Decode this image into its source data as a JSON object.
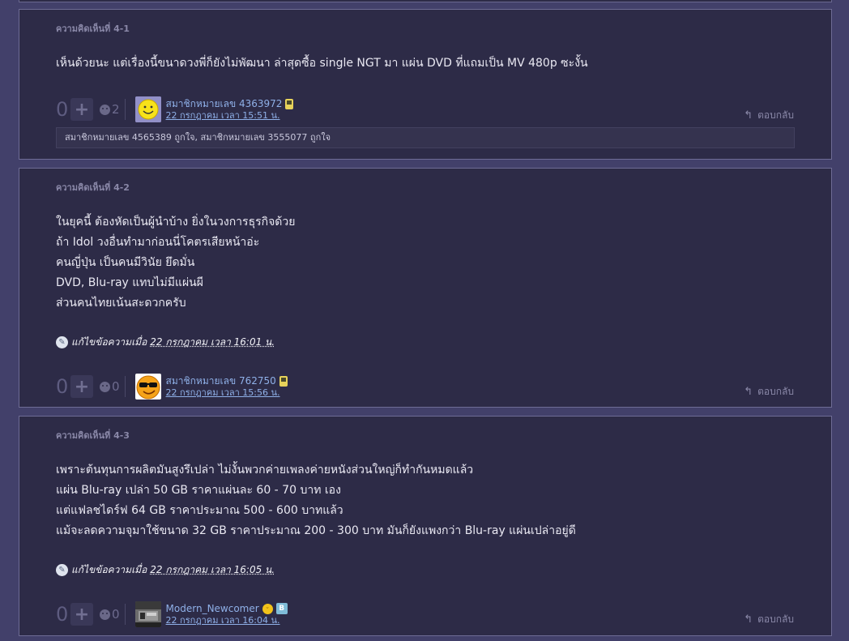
{
  "comments": [
    {
      "title": "ความคิดเห็นที่ 4-1",
      "body_lines": [
        "เห็นด้วยนะ แต่เรื่องนี้ขนาดวงพี่ก็ยังไม่พัฒนา ล่าสุดซื้อ single NGT มา แผ่น DVD ที่แถมเป็น MV 480p ซะงั้น"
      ],
      "vote_count": "0",
      "emotion_count": "2",
      "author": "สมาชิกหมายเลข 4363972",
      "date": "22 กรกฎาคม เวลา 15:51 น.",
      "reply_label": "ตอบกลับ",
      "likes_text": "สมาชิกหมายเลข 4565389 ถูกใจ, สมาชิกหมายเลข 3555077 ถูกใจ"
    },
    {
      "title": "ความคิดเห็นที่ 4-2",
      "body_lines": [
        "ในยุคนี้ ต้องหัดเป็นผู้นำบ้าง ยิ่งในวงการธุรกิจด้วย",
        "ถ้า Idol วงอื่นทำมาก่อนนี่โคตรเสียหน้าอ่ะ",
        "คนญี่ปุ่น เป็นคนมีวินัย ยึดมั่น",
        "DVD, Blu-ray แทบไม่มีแผ่นผี",
        "ส่วนคนไทยเน้นสะดวกครับ"
      ],
      "edit_label": "แก้ไขข้อความเมื่อ",
      "edit_date": "22 กรกฎาคม เวลา 16:01 น.",
      "vote_count": "0",
      "emotion_count": "0",
      "author": "สมาชิกหมายเลข 762750",
      "date": "22 กรกฎาคม เวลา 15:56 น.",
      "reply_label": "ตอบกลับ"
    },
    {
      "title": "ความคิดเห็นที่ 4-3",
      "body_lines": [
        "เพราะต้นทุนการผลิตมันสูงรึเปล่า ไม่งั้นพวกค่ายเพลงค่ายหนังส่วนใหญ่ก็ทำกันหมดแล้ว",
        "แผ่น Blu-ray เปล่า 50 GB  ราคาแผ่นละ 60 - 70 บาท เอง",
        "แต่แฟลชไดร์ฟ 64 GB ราคาประมาณ 500 - 600 บาทแล้ว",
        "แม้จะลดความจุมาใช้ขนาด 32 GB ราคาประมาณ 200 - 300 บาท มันก็ยังแพงกว่า Blu-ray แผ่นเปล่าอยู่ดี"
      ],
      "edit_label": "แก้ไขข้อความเมื่อ",
      "edit_date": "22 กรกฎาคม เวลา 16:05 น.",
      "vote_count": "0",
      "emotion_count": "0",
      "author": "Modern_Newcomer",
      "date": "22 กรกฎาคม เวลา 16:04 น.",
      "reply_label": "ตอบกลับ",
      "badge_letter": "B"
    }
  ],
  "icons": {
    "plus": "+",
    "reply": "↰",
    "edit": "✎",
    "laugh": "ᵕ"
  },
  "colors": {
    "page_bg": "#42406a",
    "card_bg": "#2d2b47",
    "link": "#8fb0e8",
    "muted": "#8a88a8"
  }
}
